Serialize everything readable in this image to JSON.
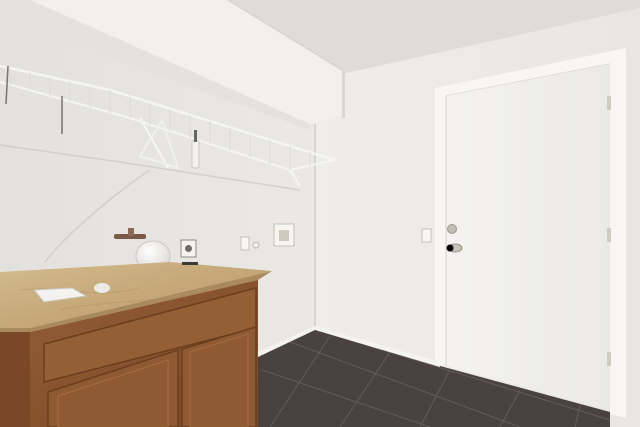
{
  "scene": {
    "kind": "photo",
    "room": "laundry-room",
    "palette": {
      "ceiling": "#dcdad6",
      "soffit": "#f1efec",
      "left_wall": "#e6e4e0",
      "back_wall": "#eeece8",
      "door": "#f3f2ef",
      "door_frame": "#f6f5f2",
      "floor_tile": "#4a4340",
      "grout": "#6c6460",
      "counter_top": "#c9ad7f",
      "cabinet_wood": "#8a5630",
      "cabinet_dark": "#6e4020",
      "wire_shelf": "#f4f4f2",
      "hardware": "#b9b4aa"
    },
    "objects": [
      "wire-shelf",
      "closet-door",
      "doorknob",
      "deadbolt",
      "wood-vanity-cabinet",
      "countertop",
      "globe-light-fixture",
      "washer-hookup-box",
      "electrical-outlet",
      "light-switch",
      "dark-tile-floor",
      "baseboard"
    ]
  }
}
